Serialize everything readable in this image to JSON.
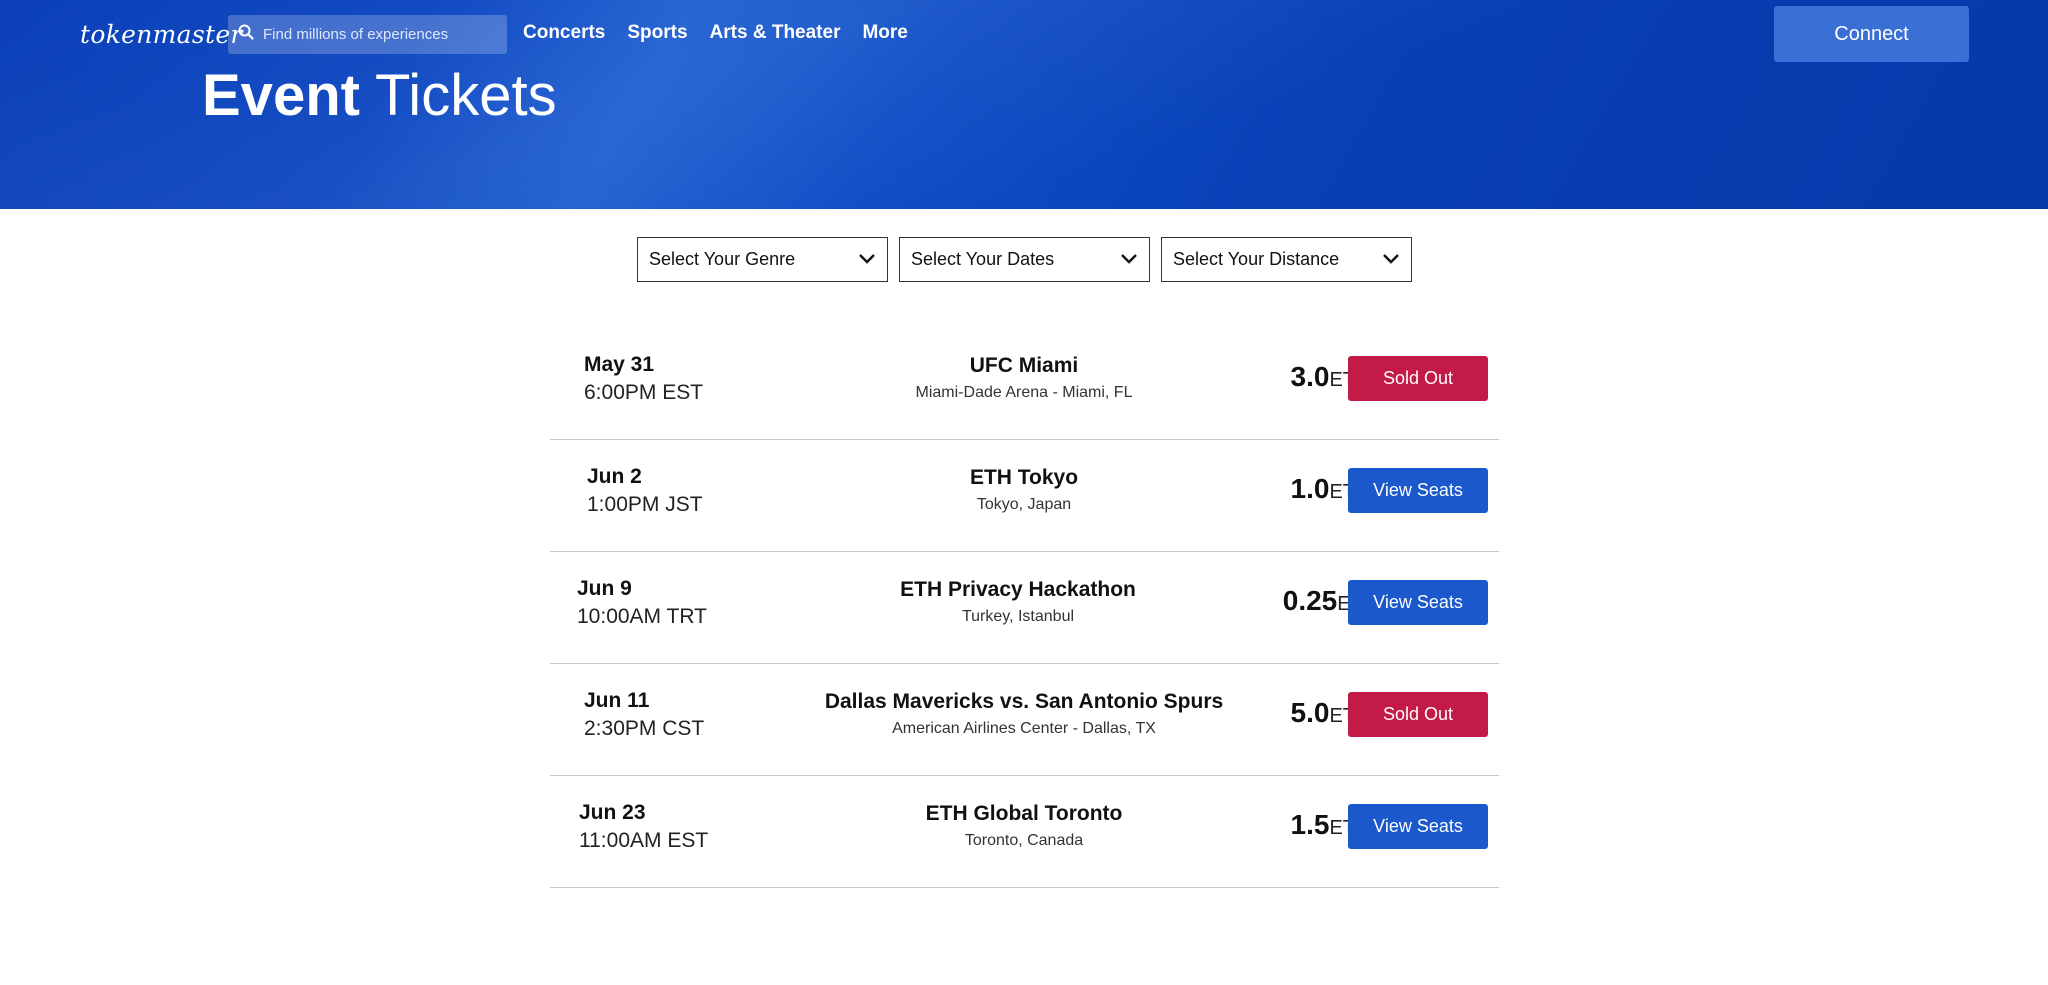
{
  "header": {
    "logo": "tokenmaster",
    "search_placeholder": "Find millions of experiences",
    "nav": [
      "Concerts",
      "Sports",
      "Arts & Theater",
      "More"
    ],
    "connect_label": "Connect",
    "title_bold": "Event",
    "title_light": "Tickets"
  },
  "filters": [
    "Select Your Genre",
    "Select Your Dates",
    "Select Your Distance"
  ],
  "events": [
    {
      "day": "May 31",
      "time": "6:00PM EST",
      "name": "UFC Miami",
      "venue": "Miami-Dade Arena - Miami, FL",
      "price": "3.0",
      "unit": "ETH",
      "button": "Sold Out",
      "status": "sold"
    },
    {
      "day": "Jun 2",
      "time": "1:00PM JST",
      "name": "ETH Tokyo",
      "venue": "Tokyo, Japan",
      "price": "1.0",
      "unit": "ETH",
      "button": "View Seats",
      "status": "view"
    },
    {
      "day": "Jun 9",
      "time": "10:00AM TRT",
      "name": "ETH Privacy Hackathon",
      "venue": "Turkey, Istanbul",
      "price": "0.25",
      "unit": "ETH",
      "button": "View Seats",
      "status": "view"
    },
    {
      "day": "Jun 11",
      "time": "2:30PM CST",
      "name": "Dallas Mavericks vs. San Antonio Spurs",
      "venue": "American Airlines Center - Dallas, TX",
      "price": "5.0",
      "unit": "ETH",
      "button": "Sold Out",
      "status": "sold"
    },
    {
      "day": "Jun 23",
      "time": "11:00AM EST",
      "name": "ETH Global Toronto",
      "venue": "Toronto, Canada",
      "price": "1.5",
      "unit": "ETH",
      "button": "View Seats",
      "status": "view"
    }
  ],
  "colors": {
    "hero": "#0b45c0",
    "sold": "#c41a47",
    "view": "#1a58cb",
    "connect": "#3a6fd6"
  },
  "icons": {
    "search": "search-icon",
    "dropdown": "chevron-down-icon"
  }
}
